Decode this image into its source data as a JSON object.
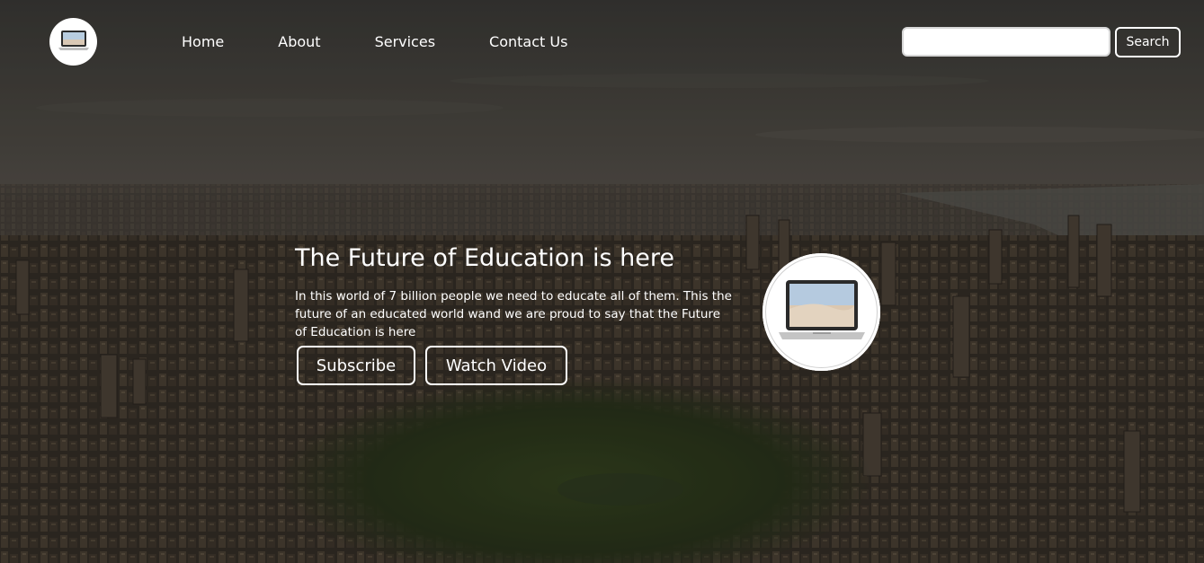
{
  "nav": {
    "logo_icon": "laptop-icon",
    "links": [
      {
        "label": "Home"
      },
      {
        "label": "About"
      },
      {
        "label": "Services"
      },
      {
        "label": "Contact Us"
      }
    ],
    "search": {
      "value": "",
      "placeholder": "",
      "button_label": "Search"
    }
  },
  "hero": {
    "title": "The Future of Education is here",
    "text": "In this world of 7 billion people we need to educate all of them. This the future of an educated world wand we are proud to say that the Future of Education is here",
    "buttons": [
      {
        "label": "Subscribe"
      },
      {
        "label": "Watch Video"
      }
    ],
    "image_icon": "laptop-icon"
  }
}
